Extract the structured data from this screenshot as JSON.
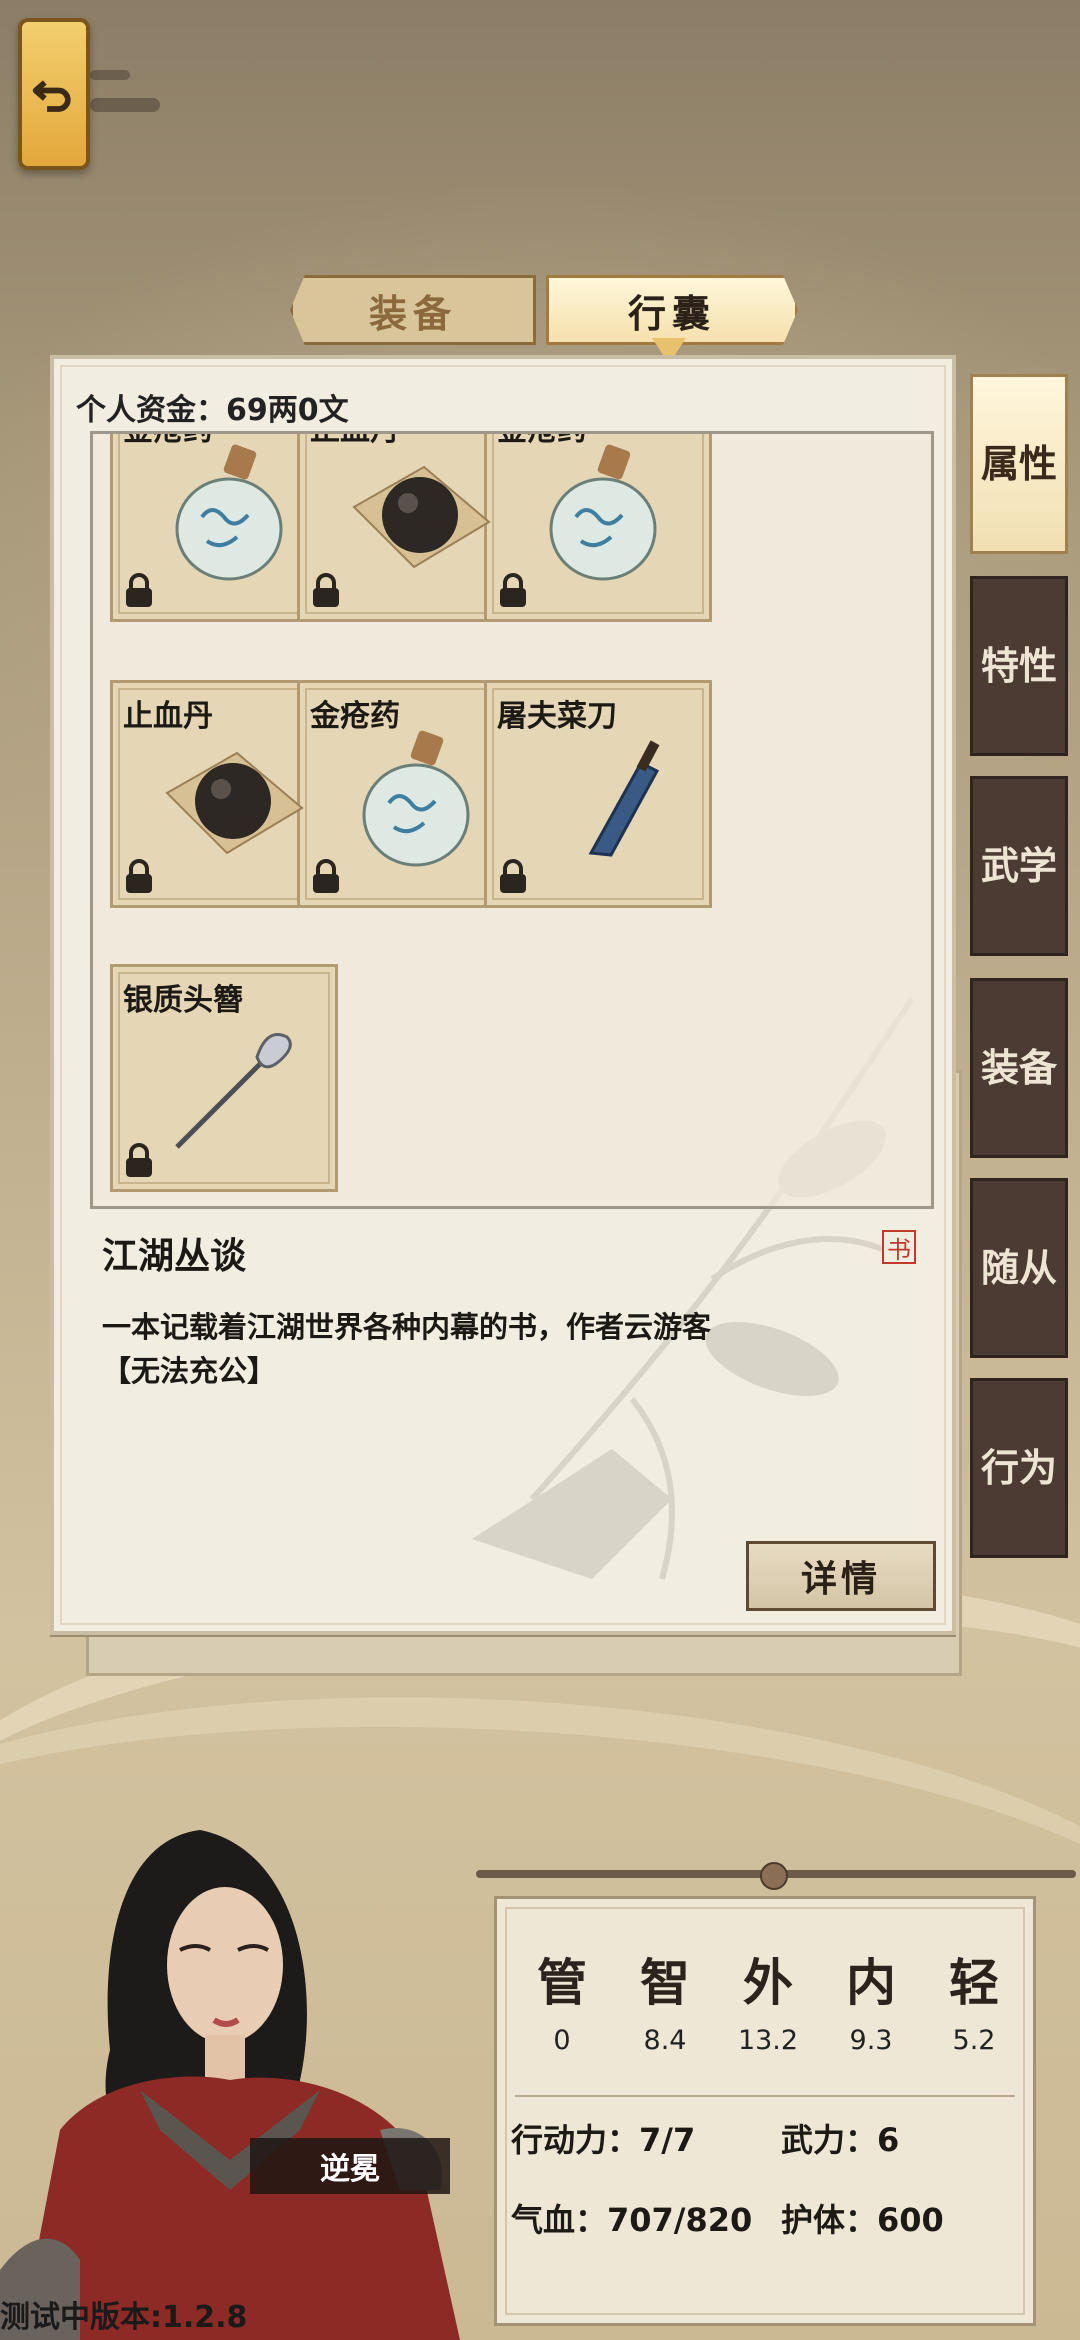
{
  "tabs": {
    "equip": "装备",
    "bag": "行囊"
  },
  "funds": "个人资金：69两0文",
  "items": [
    {
      "name": "金疮药",
      "icon": "medicine-bottle"
    },
    {
      "name": "止血丹",
      "icon": "black-pill"
    },
    {
      "name": "金疮药",
      "icon": "medicine-bottle"
    },
    {
      "name": "止血丹",
      "icon": "black-pill"
    },
    {
      "name": "金疮药",
      "icon": "medicine-bottle"
    },
    {
      "name": "屠夫菜刀",
      "icon": "cleaver"
    },
    {
      "name": "银质头簪",
      "icon": "hairpin"
    }
  ],
  "selected": {
    "title": "江湖丛谈",
    "type_badge": "书",
    "description": "一本记载着江湖世界各种内幕的书，作者云游客【无法充公】",
    "detail_button": "详情"
  },
  "side_tabs": [
    "属性",
    "特性",
    "武学",
    "装备",
    "随从",
    "行为"
  ],
  "side_active": "属性",
  "character": {
    "name": "逆冕"
  },
  "attributes": [
    {
      "label": "管",
      "value": "0"
    },
    {
      "label": "智",
      "value": "8.4"
    },
    {
      "label": "外",
      "value": "13.2"
    },
    {
      "label": "内",
      "value": "9.3"
    },
    {
      "label": "轻",
      "value": "5.2"
    }
  ],
  "stats": {
    "action": "行动力：7/7",
    "martial": "武力：6",
    "hp": "气血：707/820",
    "armor": "护体：600"
  },
  "version": "测试中版本:1.2.8",
  "colors": {
    "accent_gold": "#e8c16d",
    "panel_bg": "#f2ede1",
    "side_dark": "#4b3b33"
  }
}
